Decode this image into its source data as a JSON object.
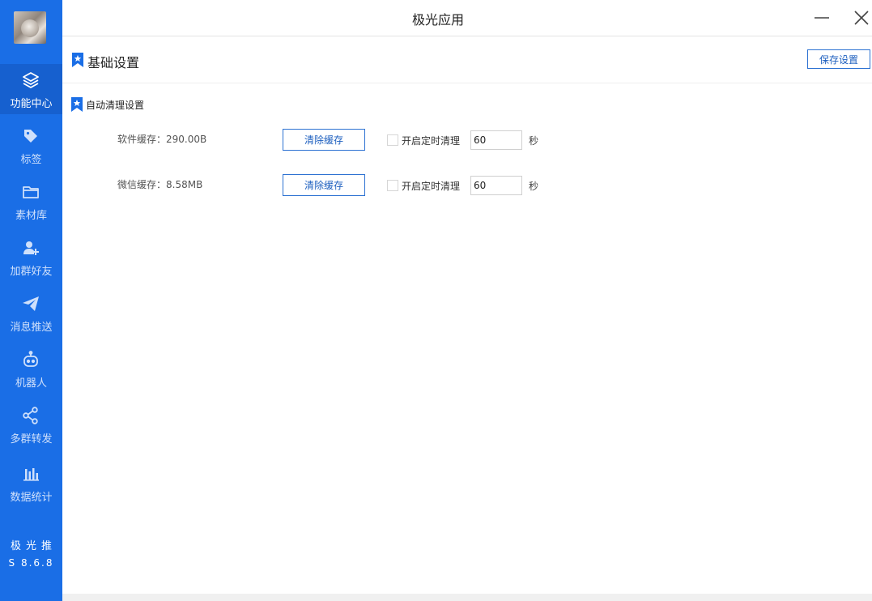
{
  "window": {
    "title": "极光应用"
  },
  "sidebar": {
    "items": [
      {
        "label": "功能中心",
        "icon": "layers-icon",
        "active": true
      },
      {
        "label": "标签",
        "icon": "tag-icon"
      },
      {
        "label": "素材库",
        "icon": "folder-icon"
      },
      {
        "label": "加群好友",
        "icon": "add-user-icon"
      },
      {
        "label": "消息推送",
        "icon": "send-icon"
      },
      {
        "label": "机器人",
        "icon": "robot-icon"
      },
      {
        "label": "多群转发",
        "icon": "share-icon"
      },
      {
        "label": "数据统计",
        "icon": "bar-chart-icon"
      }
    ],
    "brand": "极光推",
    "version": "S 8.6.8"
  },
  "header": {
    "section_title": "基础设置",
    "save_label": "保存设置"
  },
  "auto_clean": {
    "title": "自动清理设置",
    "rows": [
      {
        "label": "软件缓存：290.00B",
        "button": "清除缓存",
        "timer_label": "开启定时清理",
        "timer_value": "60",
        "unit": "秒",
        "checked": false
      },
      {
        "label": "微信缓存：8.58MB",
        "button": "清除缓存",
        "timer_label": "开启定时清理",
        "timer_value": "60",
        "unit": "秒",
        "checked": false
      }
    ]
  },
  "colors": {
    "sidebar": "#1a6ee6",
    "sidebar_active": "#1660cf",
    "accent": "#2d72d2"
  }
}
